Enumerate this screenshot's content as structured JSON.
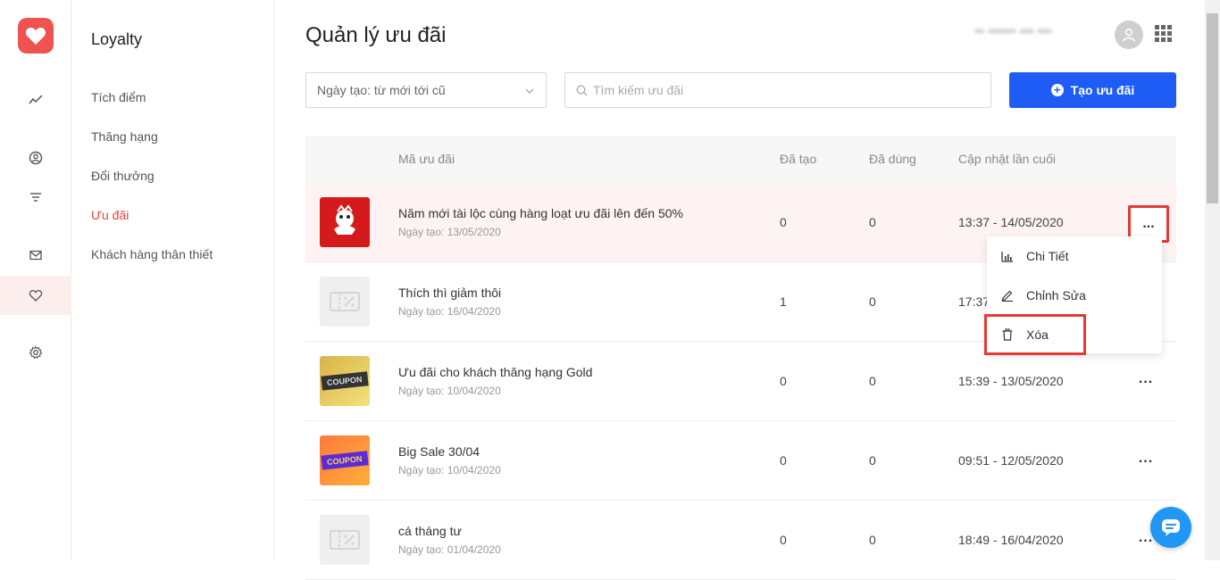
{
  "menu": {
    "title": "Loyalty",
    "items": [
      {
        "label": "Tích điểm"
      },
      {
        "label": "Thăng hạng"
      },
      {
        "label": "Đổi thưởng"
      },
      {
        "label": "Ưu đãi"
      },
      {
        "label": "Khách hàng thân thiết"
      }
    ]
  },
  "header": {
    "title": "Quản lý ưu đãi",
    "account_masked": "•• •••••• ••• •••"
  },
  "filters": {
    "sort_value": "Ngày tạo: từ mới tới cũ",
    "search_placeholder": "Tìm kiếm ưu đãi",
    "create_label": "Tạo ưu đãi"
  },
  "table": {
    "columns": {
      "code": "Mã ưu đãi",
      "created": "Đã tạo",
      "used": "Đã dùng",
      "updated": "Cập nhật lần cuối"
    },
    "rows": [
      {
        "name": "Năm mới tài lộc cùng hàng loạt ưu đãi lên đến 50%",
        "date": "Ngày tạo: 13/05/2020",
        "created": "0",
        "used": "0",
        "updated": "13:37 - 14/05/2020"
      },
      {
        "name": "Thích thì giảm thôi",
        "date": "Ngày tạo: 16/04/2020",
        "created": "1",
        "used": "0",
        "updated": "17:37"
      },
      {
        "name": "Ưu đãi cho khách thăng hạng Gold",
        "date": "Ngày tạo: 10/04/2020",
        "created": "0",
        "used": "0",
        "updated": "15:39 - 13/05/2020",
        "badge": "COUPON"
      },
      {
        "name": "Big Sale 30/04",
        "date": "Ngày tạo: 10/04/2020",
        "created": "0",
        "used": "0",
        "updated": "09:51 - 12/05/2020",
        "badge": "COUPON"
      },
      {
        "name": "cá tháng tư",
        "date": "Ngày tạo: 01/04/2020",
        "created": "0",
        "used": "0",
        "updated": "18:49 - 16/04/2020"
      }
    ]
  },
  "dropdown": {
    "detail": "Chi Tiết",
    "edit": "Chỉnh Sửa",
    "delete": "Xóa"
  },
  "more_glyph": "..."
}
